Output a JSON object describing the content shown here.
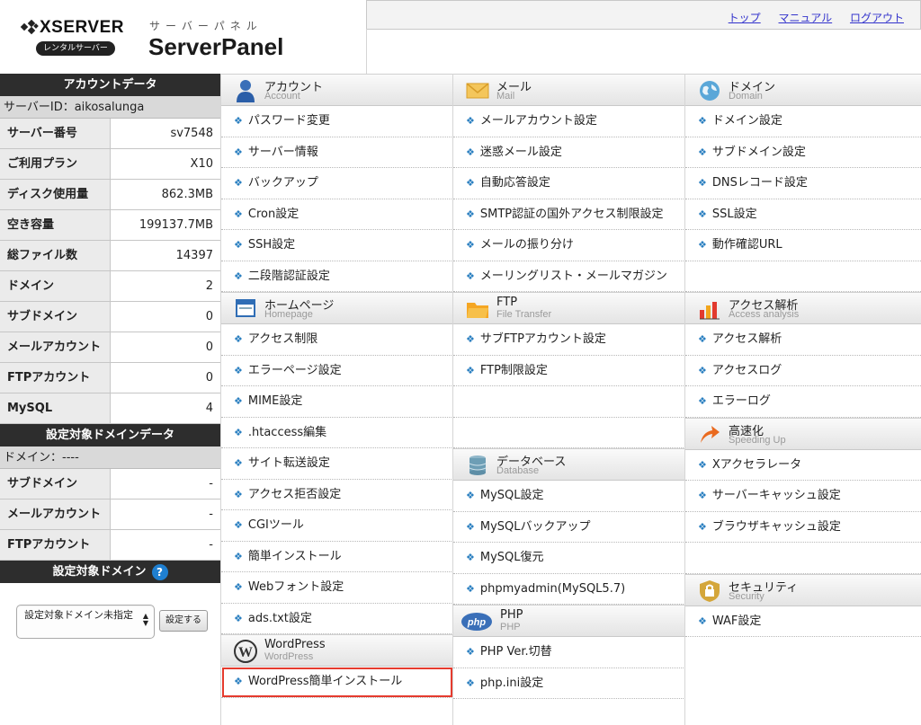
{
  "header": {
    "brand": "XSERVER",
    "brand_badge": "レンタルサーバー",
    "panel_kana": "サーバーパネル",
    "panel_title": "ServerPanel",
    "links": [
      "トップ",
      "マニュアル",
      "ログアウト"
    ]
  },
  "sidebar": {
    "account_title": "アカウントデータ",
    "server_id": "サーバーID：aikosalunga",
    "account_rows": [
      {
        "label": "サーバー番号",
        "value": "sv7548"
      },
      {
        "label": "ご利用プラン",
        "value": "X10"
      },
      {
        "label": "ディスク使用量",
        "value": "862.3MB"
      },
      {
        "label": "空き容量",
        "value": "199137.7MB"
      },
      {
        "label": "総ファイル数",
        "value": "14397"
      },
      {
        "label": "ドメイン",
        "value": "2"
      },
      {
        "label": "サブドメイン",
        "value": "0"
      },
      {
        "label": "メールアカウント",
        "value": "0"
      },
      {
        "label": "FTPアカウント",
        "value": "0"
      },
      {
        "label": "MySQL",
        "value": "4"
      }
    ],
    "domain_data_title": "設定対象ドメインデータ",
    "domain_line": "ドメイン：----",
    "domain_rows": [
      {
        "label": "サブドメイン",
        "value": "-"
      },
      {
        "label": "メールアカウント",
        "value": "-"
      },
      {
        "label": "FTPアカウント",
        "value": "-"
      }
    ],
    "target_domain_title": "設定対象ドメイン",
    "help_glyph": "?",
    "select_value": "設定対象ドメイン未指定",
    "set_button": "設定する"
  },
  "columns": [
    [
      {
        "title": "アカウント",
        "subtitle": "Account",
        "icon": "account-icon",
        "items": [
          "パスワード変更",
          "サーバー情報",
          "バックアップ",
          "Cron設定",
          "SSH設定",
          "二段階認証設定"
        ]
      },
      {
        "title": "ホームページ",
        "subtitle": "Homepage",
        "icon": "homepage-icon",
        "items": [
          "アクセス制限",
          "エラーページ設定",
          "MIME設定",
          ".htaccess編集",
          "サイト転送設定",
          "アクセス拒否設定",
          "CGIツール",
          "簡単インストール",
          "Webフォント設定",
          "ads.txt設定"
        ]
      },
      {
        "title": "WordPress",
        "subtitle": "WordPress",
        "icon": "wordpress-icon",
        "items": [
          "WordPress簡単インストール"
        ]
      }
    ],
    [
      {
        "title": "メール",
        "subtitle": "Mail",
        "icon": "mail-icon",
        "items": [
          "メールアカウント設定",
          "迷惑メール設定",
          "自動応答設定",
          "SMTP認証の国外アクセス制限設定",
          "メールの振り分け",
          "メーリングリスト・メールマガジン"
        ]
      },
      {
        "title": "FTP",
        "subtitle": "File Transfer",
        "icon": "ftp-folder-icon",
        "items": [
          "サブFTPアカウント設定",
          "FTP制限設定",
          "",
          ""
        ]
      },
      {
        "title": "データベース",
        "subtitle": "Database",
        "icon": "database-icon",
        "items": [
          "MySQL設定",
          "MySQLバックアップ",
          "MySQL復元",
          "phpmyadmin(MySQL5.7)"
        ]
      },
      {
        "title": "PHP",
        "subtitle": "PHP",
        "icon": "php-icon",
        "items": [
          "PHP Ver.切替",
          "php.ini設定"
        ]
      }
    ],
    [
      {
        "title": "ドメイン",
        "subtitle": "Domain",
        "icon": "domain-globe-icon",
        "items": [
          "ドメイン設定",
          "サブドメイン設定",
          "DNSレコード設定",
          "SSL設定",
          "動作確認URL",
          ""
        ]
      },
      {
        "title": "アクセス解析",
        "subtitle": "Access analysis",
        "icon": "access-analysis-icon",
        "items": [
          "アクセス解析",
          "アクセスログ",
          "エラーログ"
        ]
      },
      {
        "title": "高速化",
        "subtitle": "Speeding Up",
        "icon": "speed-icon",
        "items": [
          "Xアクセラレータ",
          "サーバーキャッシュ設定",
          "ブラウザキャッシュ設定",
          ""
        ]
      },
      {
        "title": "セキュリティ",
        "subtitle": "Security",
        "icon": "security-lock-icon",
        "items": [
          "WAF設定"
        ]
      }
    ]
  ],
  "highlighted_item": "WordPress簡単インストール"
}
